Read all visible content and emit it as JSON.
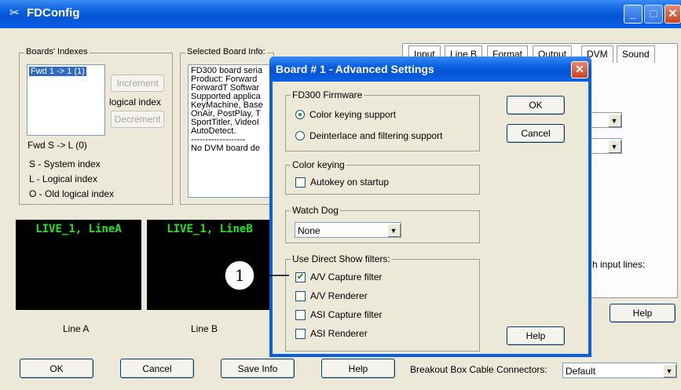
{
  "main": {
    "title": "FDConfig",
    "app_icon": "tools-icon",
    "boards_group": {
      "legend": "Boards' Indexes",
      "list_items": [
        "Fwd 1 -> 1 (1)"
      ],
      "increment": "Increment",
      "logical_index": "logical index",
      "decrement": "Decrement",
      "fwd_sl": "Fwd S -> L (0)",
      "legend_s": "S - System index",
      "legend_l": "L - Logical index",
      "legend_o": "O - Old logical index"
    },
    "selected_group": {
      "legend": "Selected Board Info:",
      "lines": [
        "FD300 board seria",
        "Product: Forward",
        "ForwardT Softwar",
        "Supported applica",
        "KeyMachine, Base",
        "OnAir, PostPlay, T",
        "SportTitler, VideoI",
        "AutoDetect.",
        "-------------------",
        "No DVM board de"
      ]
    },
    "tabs": [
      "Input",
      "Line B",
      "Format",
      "Output",
      "DVM",
      "Sound"
    ],
    "right_partial_text": "h input lines:",
    "previews": [
      {
        "label": "LIVE_1, LineA",
        "caption": "Line A"
      },
      {
        "label": "LIVE_1, LineB",
        "caption": "Line B"
      }
    ],
    "buttons": {
      "ok": "OK",
      "cancel": "Cancel",
      "save_info": "Save Info",
      "help": "Help",
      "right_help": "Help"
    },
    "breakout": {
      "label": "Breakout Box Cable Connectors:",
      "value": "Default"
    }
  },
  "dialog": {
    "title": "Board # 1 - Advanced Settings",
    "firmware": {
      "legend": "FD300 Firmware",
      "option1": "Color keying support",
      "option2": "Deinterlace and filtering support",
      "selected": 1
    },
    "color_keying": {
      "legend": "Color keying",
      "autokey": "Autokey on startup",
      "autokey_checked": false
    },
    "watchdog": {
      "legend": "Watch Dog",
      "value": "None"
    },
    "directshow": {
      "legend": "Use Direct Show filters:",
      "items": [
        {
          "label": "A/V Capture filter",
          "checked": true
        },
        {
          "label": "A/V Renderer",
          "checked": false
        },
        {
          "label": "ASI Capture filter",
          "checked": false
        },
        {
          "label": "ASI Renderer",
          "checked": false
        }
      ]
    },
    "ok": "OK",
    "cancel": "Cancel",
    "help": "Help"
  },
  "callout": {
    "number": "1"
  }
}
